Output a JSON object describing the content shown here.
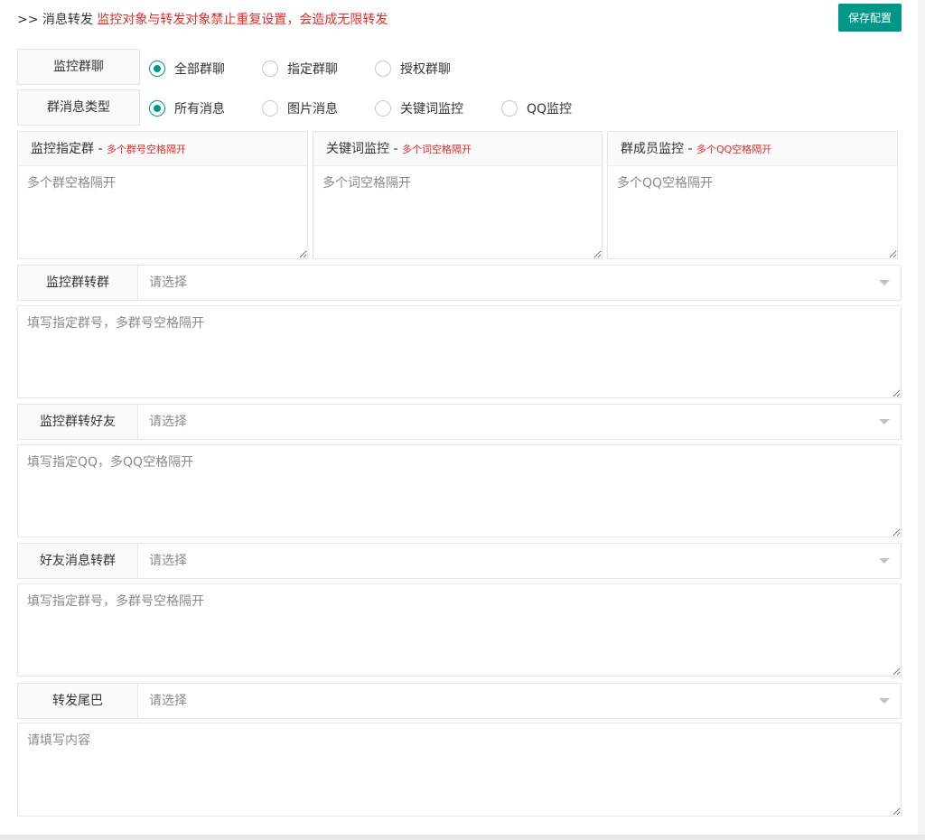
{
  "header": {
    "prefix": ">> 消息转发",
    "warning": "监控对象与转发对象禁止重复设置，会造成无限转发",
    "save_label": "保存配置"
  },
  "monitor_group": {
    "label": "监控群聊",
    "options": [
      "全部群聊",
      "指定群聊",
      "授权群聊"
    ],
    "selected": "全部群聊"
  },
  "message_type": {
    "label": "群消息类型",
    "options": [
      "所有消息",
      "图片消息",
      "关键词监控",
      "QQ监控"
    ],
    "selected": "所有消息"
  },
  "cards": [
    {
      "title": "监控指定群",
      "hint": "多个群号空格隔开",
      "placeholder": "多个群空格隔开"
    },
    {
      "title": "关键词监控",
      "hint": "多个词空格隔开",
      "placeholder": "多个词空格隔开"
    },
    {
      "title": "群成员监控",
      "hint": "多个QQ空格隔开",
      "placeholder": "多个QQ空格隔开"
    }
  ],
  "forward_rows": [
    {
      "label": "监控群转群",
      "select_value": "请选择",
      "placeholder": "填写指定群号，多群号空格隔开"
    },
    {
      "label": "监控群转好友",
      "select_value": "请选择",
      "placeholder": "填写指定QQ，多QQ空格隔开"
    },
    {
      "label": "好友消息转群",
      "select_value": "请选择",
      "placeholder": "填写指定群号，多群号空格隔开"
    },
    {
      "label": "转发尾巴",
      "select_value": "请选择",
      "placeholder": "请填写内容"
    }
  ],
  "accent_color": "#009688",
  "warning_color": "#e52a2a"
}
